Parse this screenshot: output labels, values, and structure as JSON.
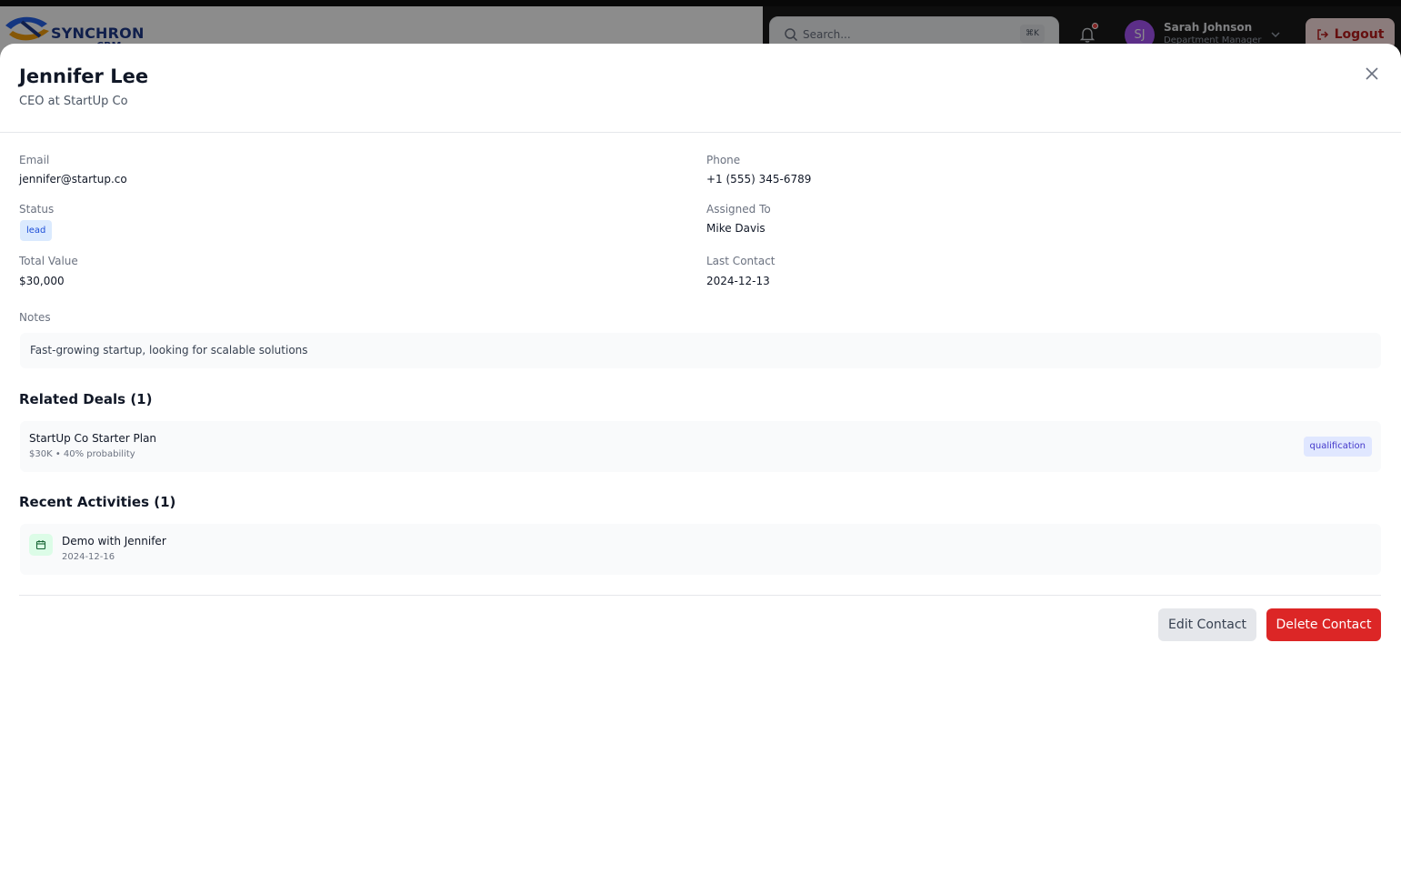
{
  "app": {
    "logo_text": "SYNCHRON",
    "logo_sub": "CRM",
    "search": {
      "placeholder": "Search...",
      "shortcut": "⌘K"
    },
    "user": {
      "initials": "SJ",
      "name": "Sarah Johnson",
      "role": "Department Manager"
    },
    "logout_label": "Logout"
  },
  "contact": {
    "name": "Jennifer Lee",
    "title": "CEO at StartUp Co",
    "fields": {
      "email_label": "Email",
      "email": "jennifer@startup.co",
      "phone_label": "Phone",
      "phone": "+1 (555) 345-6789",
      "status_label": "Status",
      "status": "lead",
      "assigned_label": "Assigned To",
      "assigned": "Mike Davis",
      "value_label": "Total Value",
      "value": "$30,000",
      "last_contact_label": "Last Contact",
      "last_contact": "2024-12-13"
    },
    "notes_label": "Notes",
    "notes": "Fast-growing startup, looking for scalable solutions"
  },
  "deals": {
    "title": "Related Deals (1)",
    "items": [
      {
        "name": "StartUp Co Starter Plan",
        "meta": "$30K • 40% probability",
        "stage": "qualification"
      }
    ]
  },
  "activities": {
    "title": "Recent Activities (1)",
    "items": [
      {
        "title": "Demo with Jennifer",
        "date": "2024-12-16",
        "icon": "calendar-icon"
      }
    ]
  },
  "actions": {
    "edit_label": "Edit Contact",
    "delete_label": "Delete Contact"
  },
  "colors": {
    "accent_danger": "#dc2626",
    "status_badge": "#dbeafe",
    "stage_badge": "#e0e7ff",
    "avatar": "#a855f7"
  }
}
